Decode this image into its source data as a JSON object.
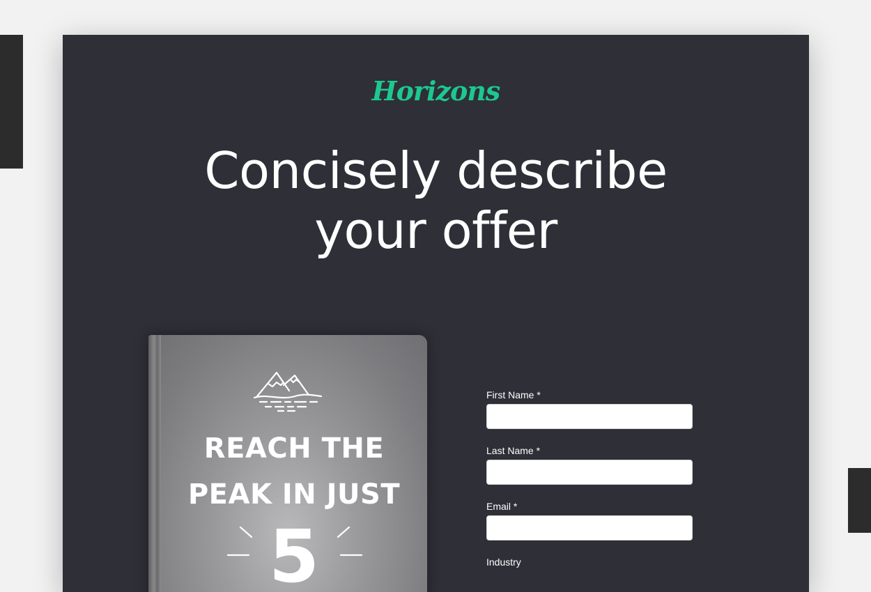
{
  "brand": {
    "logo_text": "Horizons",
    "accent_color": "#1cc88f"
  },
  "hero": {
    "headline_line1": "Concisely describe",
    "headline_line2": "your offer"
  },
  "book": {
    "title_line1": "REACH THE",
    "title_line2": "PEAK IN JUST",
    "number": "5",
    "icon": "mountain-icon"
  },
  "form": {
    "first_name": {
      "label": "First Name *",
      "value": ""
    },
    "last_name": {
      "label": "Last Name *",
      "value": ""
    },
    "email": {
      "label": "Email *",
      "value": ""
    },
    "industry": {
      "label": "Industry"
    }
  }
}
